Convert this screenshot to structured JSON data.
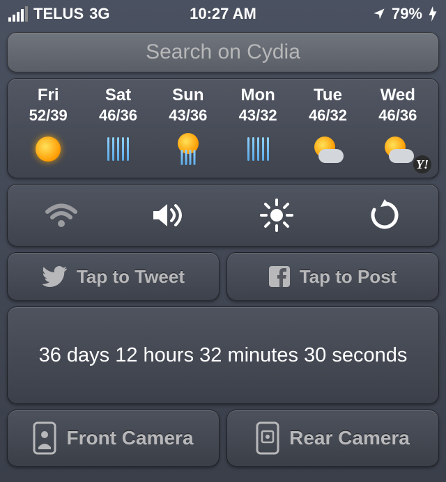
{
  "status": {
    "carrier": "TELUS",
    "network": "3G",
    "time": "10:27 AM",
    "battery_percent": "79%"
  },
  "search": {
    "placeholder": "Search on Cydia"
  },
  "weather": {
    "days": [
      {
        "name": "Fri",
        "temps": "52/39",
        "icon": "sun"
      },
      {
        "name": "Sat",
        "temps": "46/36",
        "icon": "rain"
      },
      {
        "name": "Sun",
        "temps": "43/36",
        "icon": "sun-rain"
      },
      {
        "name": "Mon",
        "temps": "43/32",
        "icon": "rain"
      },
      {
        "name": "Tue",
        "temps": "46/32",
        "icon": "suncloud"
      },
      {
        "name": "Wed",
        "temps": "46/36",
        "icon": "suncloud"
      }
    ],
    "provider_badge": "Y!"
  },
  "social": {
    "tweet_label": "Tap to Tweet",
    "post_label": "Tap to Post"
  },
  "countdown": {
    "text": "36 days 12 hours 32 minutes 30 seconds"
  },
  "camera": {
    "front_label": "Front Camera",
    "rear_label": "Rear Camera"
  }
}
